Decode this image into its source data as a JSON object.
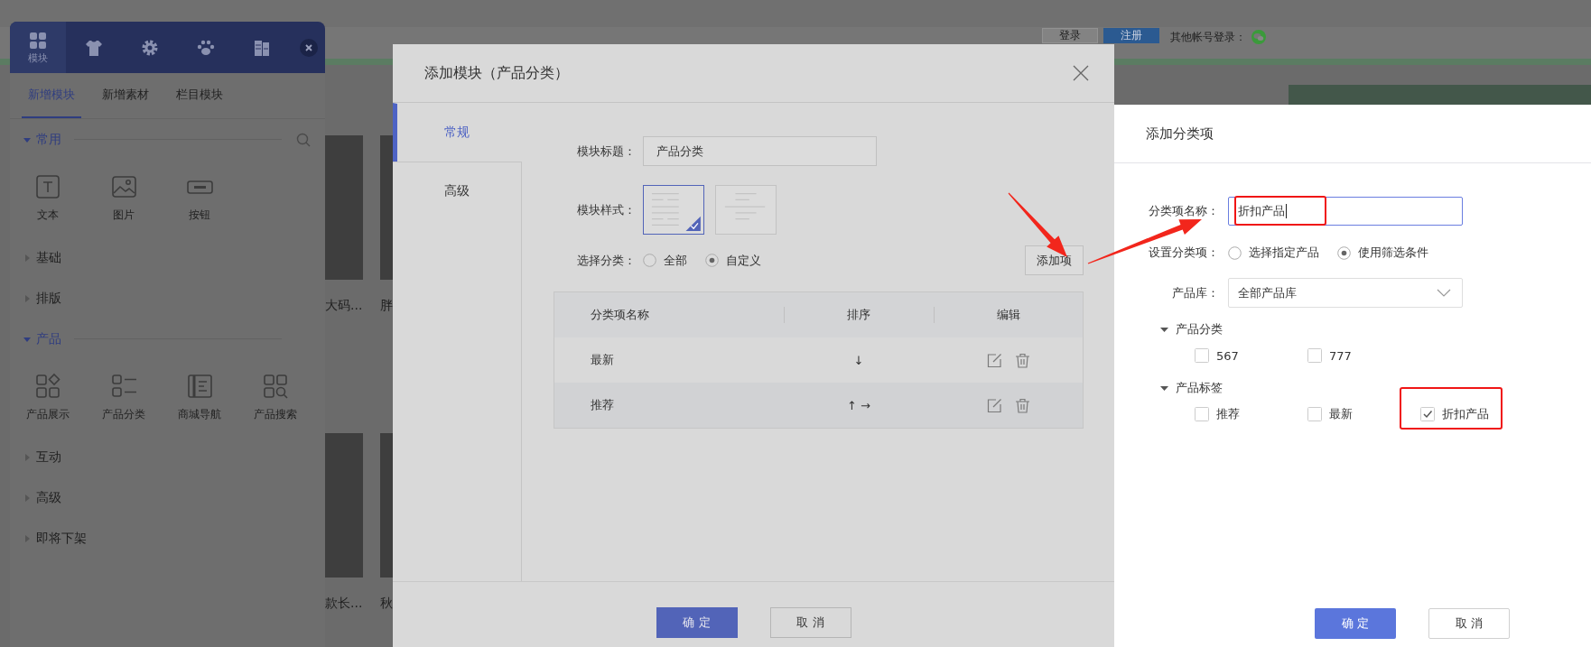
{
  "page_header": {
    "login_button": "登录",
    "register_button": "注册",
    "other_login_label": "其他帐号登录："
  },
  "background_products": [
    {
      "caption": "大码..."
    },
    {
      "caption": "胖"
    },
    {
      "caption": "款长..."
    },
    {
      "caption": "秋"
    }
  ],
  "module_panel": {
    "icon_tabs": [
      {
        "label": "模块",
        "selected": true
      },
      {
        "selected": false
      },
      {
        "selected": false
      },
      {
        "selected": false
      },
      {
        "selected": false
      }
    ],
    "tabs": [
      {
        "label": "新增模块",
        "selected": true
      },
      {
        "label": "新增素材",
        "selected": false
      },
      {
        "label": "栏目模块",
        "selected": false
      }
    ],
    "sections": [
      {
        "label": "常用",
        "expanded": true,
        "items": [
          {
            "label": "文本"
          },
          {
            "label": "图片"
          },
          {
            "label": "按钮"
          }
        ]
      },
      {
        "label": "基础",
        "expanded": false
      },
      {
        "label": "排版",
        "expanded": false
      },
      {
        "label": "产品",
        "expanded": true,
        "items": [
          {
            "label": "产品展示"
          },
          {
            "label": "产品分类"
          },
          {
            "label": "商城导航"
          },
          {
            "label": "产品搜索"
          }
        ]
      },
      {
        "label": "互动",
        "expanded": false
      },
      {
        "label": "高级",
        "expanded": false
      },
      {
        "label": "即将下架",
        "expanded": false
      }
    ]
  },
  "dialog": {
    "title": "添加模块（产品分类）",
    "nav": [
      {
        "label": "常规",
        "selected": true
      },
      {
        "label": "高级",
        "selected": false
      }
    ],
    "module_title": {
      "label": "模块标题：",
      "value": "产品分类"
    },
    "module_style": {
      "label": "模块样式：",
      "options": [
        {
          "selected": true
        },
        {
          "selected": false
        }
      ]
    },
    "category_choice": {
      "label": "选择分类：",
      "options": [
        {
          "label": "全部",
          "selected": false
        },
        {
          "label": "自定义",
          "selected": true
        }
      ]
    },
    "add_item_button": "添加项",
    "table": {
      "columns": [
        "分类项名称",
        "排序",
        "编辑"
      ],
      "rows": [
        {
          "name": "最新",
          "sort": "↓"
        },
        {
          "name": "推荐",
          "sort": "↑ →"
        }
      ]
    },
    "buttons": [
      {
        "label": "确 定",
        "kind": "primary"
      },
      {
        "label": "取 消",
        "kind": "secondary"
      }
    ]
  },
  "category_panel": {
    "title": "添加分类项",
    "name_field": {
      "label": "分类项名称：",
      "value": "折扣产品"
    },
    "mode": {
      "label": "设置分类项：",
      "options": [
        {
          "label": "选择指定产品",
          "selected": false
        },
        {
          "label": "使用筛选条件",
          "selected": true
        }
      ]
    },
    "library": {
      "label": "产品库：",
      "value": "全部产品库"
    },
    "groups": [
      {
        "label": "产品分类",
        "expanded": true,
        "options": [
          {
            "label": "567",
            "checked": false
          },
          {
            "label": "777",
            "checked": false
          }
        ]
      },
      {
        "label": "产品标签",
        "expanded": true,
        "options": [
          {
            "label": "推荐",
            "checked": false
          },
          {
            "label": "最新",
            "checked": false
          },
          {
            "label": "折扣产品",
            "checked": true
          }
        ]
      }
    ],
    "buttons": [
      {
        "label": "确 定",
        "kind": "primary"
      },
      {
        "label": "取 消",
        "kind": "secondary"
      }
    ]
  }
}
